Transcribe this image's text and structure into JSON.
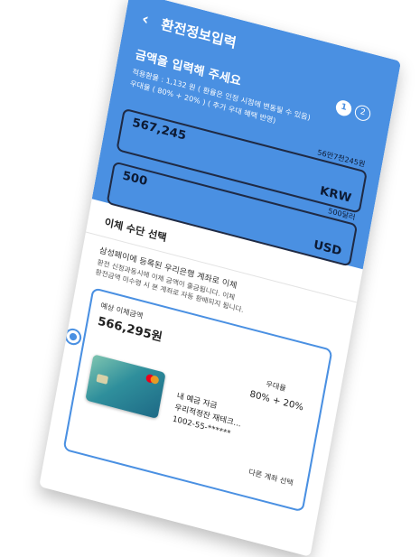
{
  "header": {
    "title": "환전정보입력",
    "headline": "금액을 입력해 주세요",
    "steps": [
      "1",
      "2"
    ],
    "rate_line1": "적용환율 : 1,132 원 ( 환율은 인정 시점에 변동될 수 있음)",
    "rate_line2": "우대율 ( 80% + 20% ) ( 추가 우대 혜택 반영)"
  },
  "krw": {
    "value": "567,245",
    "currency": "KRW",
    "note": "56만7천245원"
  },
  "usd": {
    "value": "500",
    "currency": "USD",
    "note": "500달러"
  },
  "payment": {
    "section_title": "이체 수단 선택",
    "desc_main": "삼성페이에 등록된 우리은행 계좌로 이체",
    "desc_sub1": "환전 신청과동시에 이체 금액이 출금됩니다. 이체",
    "desc_sub2": "환전금액 미수령 시 본 계좌로 자동 환배되지 됩니다.",
    "expected_label": "예상 이체금액",
    "expected_amount": "566,295원",
    "pref_label": "우대율",
    "pref_value": "80% + 20%",
    "account_line1": "내 예금 자금",
    "account_line2": "우리적정잔 재테크...",
    "account_line3": "1002-55-******",
    "other_account": "다른 계좌 선택"
  },
  "colors": {
    "accent": "#4a90e2",
    "outline": "#1f2a44"
  }
}
